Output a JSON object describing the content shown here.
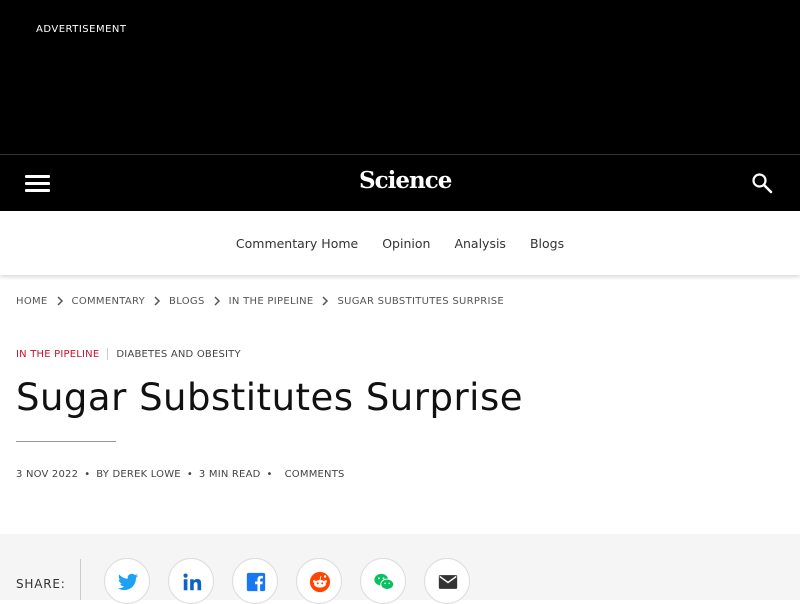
{
  "ad": {
    "label": "ADVERTISEMENT"
  },
  "header": {
    "logo": "Science"
  },
  "subnav": [
    "Commentary Home",
    "Opinion",
    "Analysis",
    "Blogs"
  ],
  "breadcrumb": [
    "HOME",
    "COMMENTARY",
    "BLOGS",
    "IN THE PIPELINE",
    "SUGAR SUBSTITUTES SURPRISE"
  ],
  "categories": {
    "primary": "IN THE PIPELINE",
    "secondary": "DIABETES AND OBESITY"
  },
  "article": {
    "title": "Sugar Substitutes Surprise",
    "date": "3 NOV 2022",
    "author": "BY DEREK LOWE",
    "read_time": "3 MIN READ",
    "comments": "COMMENTS"
  },
  "share": {
    "label": "SHARE:"
  },
  "colors": {
    "accent": "#c8102e",
    "twitter": "#1da1f2",
    "linkedin": "#0a66c2",
    "facebook": "#1877f2",
    "reddit": "#ff4500",
    "wechat": "#07c160"
  }
}
